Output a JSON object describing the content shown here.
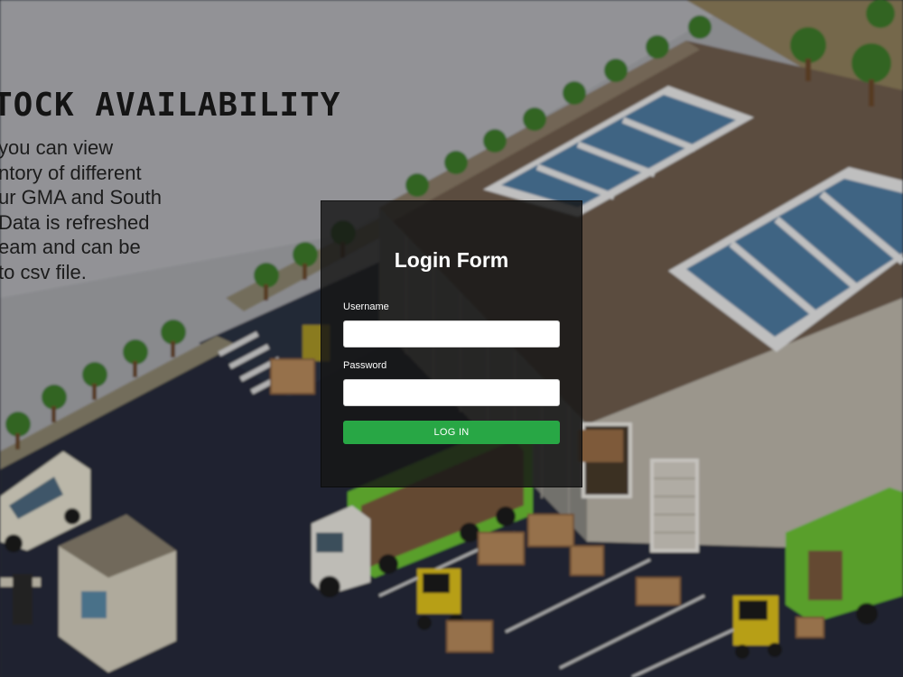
{
  "hero": {
    "title": "TOCK AVAILABILITY",
    "lines": [
      " you can view",
      "ntory of different",
      "ur GMA and South",
      "Data is refreshed",
      "eam and can be",
      "to csv file."
    ]
  },
  "login": {
    "title": "Login Form",
    "username_label": "Username",
    "username_value": "",
    "password_label": "Password",
    "password_value": "",
    "submit_label": "LOG IN"
  },
  "colors": {
    "button": "#28a745",
    "panel": "#161616",
    "road": "#252a3a",
    "truck": "#6dc234"
  }
}
